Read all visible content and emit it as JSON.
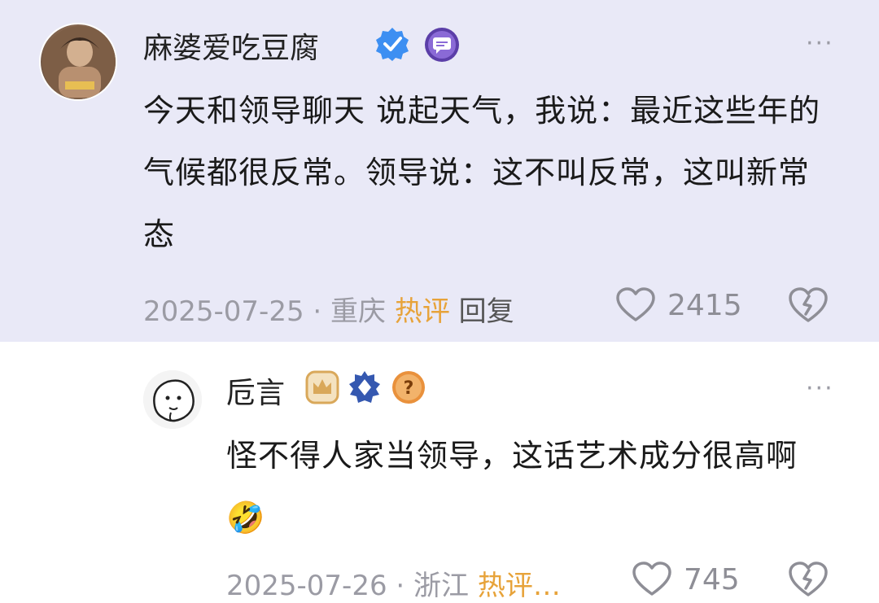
{
  "comments": [
    {
      "username": "麻婆爱吃豆腐",
      "badges": [
        "verified-check-icon",
        "message-badge-icon"
      ],
      "text": "今天和领导聊天 说起天气，我说：最近这些年的气候都很反常。领导说：这不叫反常，这叫新常态",
      "date": "2025-07-25",
      "separator": "·",
      "location": "重庆",
      "hot_label": "热评",
      "reply_label": "回复",
      "likes": "2415",
      "more": "···",
      "colors": {
        "background": "#e9e9f7",
        "hot": "#e7a33a"
      }
    },
    {
      "username": "卮言",
      "badges": [
        "crown-badge-icon",
        "diamond-badge-icon",
        "question-badge-icon"
      ],
      "text": "怪不得人家当领导，这话艺术成分很高啊",
      "emoji": "🤣",
      "date": "2025-07-26",
      "separator": "·",
      "location": "浙江",
      "hot_label": "热评…",
      "likes": "745",
      "more": "···"
    }
  ]
}
